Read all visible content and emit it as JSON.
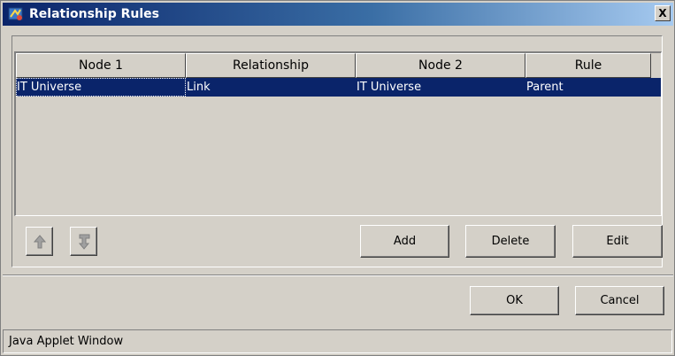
{
  "window": {
    "title": "Relationship Rules",
    "close_label": "X"
  },
  "table": {
    "columns": [
      "Node 1",
      "Relationship",
      "Node 2",
      "Rule"
    ],
    "rows": [
      [
        "IT Universe",
        "Link",
        "IT Universe",
        "Parent"
      ]
    ],
    "selected_row": 0
  },
  "buttons": {
    "move_up_icon": "up-arrow-icon",
    "move_down_icon": "down-turn-arrow-icon",
    "add": "Add",
    "delete": "Delete",
    "edit": "Edit",
    "ok": "OK",
    "cancel": "Cancel"
  },
  "status_bar": {
    "text": "Java Applet Window"
  },
  "colors": {
    "title_gradient_start": "#0a246a",
    "title_gradient_end": "#a6caf0",
    "selection": "#0a246a",
    "face": "#d4d0c8"
  }
}
